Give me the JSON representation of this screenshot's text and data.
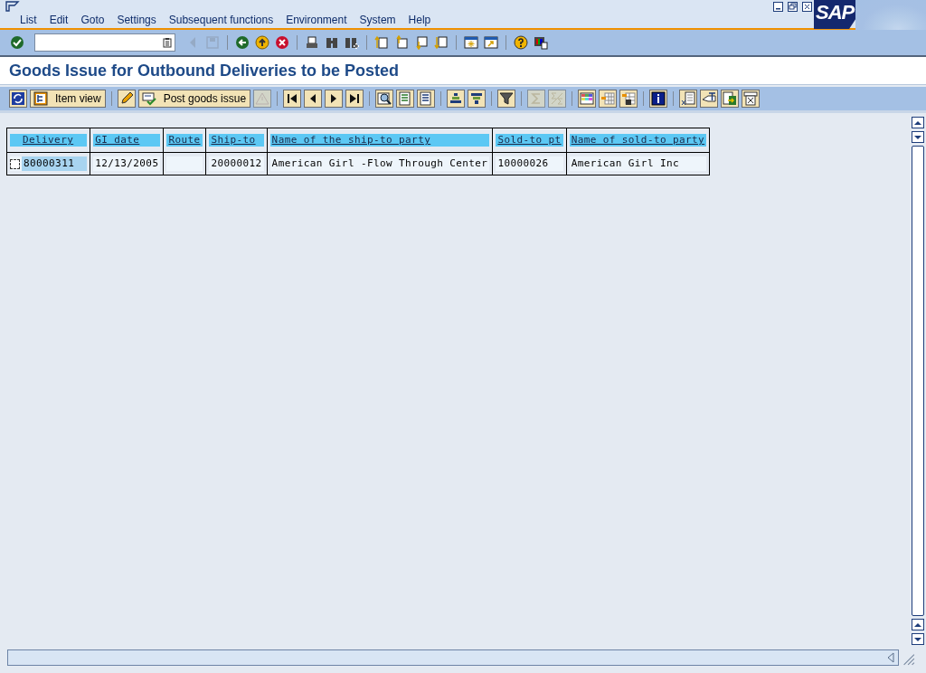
{
  "menu_bar": {
    "items": [
      "List",
      "Edit",
      "Goto",
      "Settings",
      "Subsequent functions",
      "Environment",
      "System",
      "Help"
    ]
  },
  "logo": "SAP",
  "system_toolbar": [
    {
      "kind": "icon",
      "disabled": false
    },
    {
      "kind": "field"
    },
    {
      "kind": "icon",
      "disabled": true
    },
    {
      "kind": "icon",
      "disabled": true
    },
    {
      "kind": "sep"
    },
    {
      "kind": "icon",
      "disabled": false
    },
    {
      "kind": "icon",
      "disabled": false
    },
    {
      "kind": "icon",
      "disabled": false
    },
    {
      "kind": "sep"
    },
    {
      "kind": "icon",
      "disabled": false
    },
    {
      "kind": "icon",
      "disabled": false
    },
    {
      "kind": "icon",
      "disabled": false
    },
    {
      "kind": "sep"
    },
    {
      "kind": "icon",
      "disabled": false
    },
    {
      "kind": "icon",
      "disabled": false
    },
    {
      "kind": "icon",
      "disabled": false
    },
    {
      "kind": "icon",
      "disabled": false
    },
    {
      "kind": "sep"
    },
    {
      "kind": "icon",
      "disabled": false
    },
    {
      "kind": "icon",
      "disabled": false
    },
    {
      "kind": "sep"
    },
    {
      "kind": "icon",
      "disabled": false
    },
    {
      "kind": "icon",
      "disabled": false
    }
  ],
  "title": "Goods Issue for Outbound Deliveries to be Posted",
  "application_toolbar": [
    {
      "kind": "icon",
      "disabled": false
    },
    {
      "kind": "button",
      "label": "Item view",
      "disabled": false
    },
    {
      "kind": "sep"
    },
    {
      "kind": "icon",
      "disabled": false
    },
    {
      "kind": "button",
      "label": "Post goods issue",
      "disabled": false
    },
    {
      "kind": "icon",
      "disabled": true
    },
    {
      "kind": "sep"
    },
    {
      "kind": "icon",
      "disabled": false
    },
    {
      "kind": "icon",
      "disabled": false
    },
    {
      "kind": "icon",
      "disabled": false
    },
    {
      "kind": "icon",
      "disabled": false
    },
    {
      "kind": "sep"
    },
    {
      "kind": "icon",
      "disabled": false
    },
    {
      "kind": "icon",
      "disabled": false
    },
    {
      "kind": "icon",
      "disabled": false
    },
    {
      "kind": "sep"
    },
    {
      "kind": "icon",
      "disabled": false
    },
    {
      "kind": "icon",
      "disabled": false
    },
    {
      "kind": "sep"
    },
    {
      "kind": "icon",
      "disabled": false
    },
    {
      "kind": "sep"
    },
    {
      "kind": "icon",
      "disabled": true
    },
    {
      "kind": "icon",
      "disabled": true
    },
    {
      "kind": "sep"
    },
    {
      "kind": "icon",
      "disabled": false
    },
    {
      "kind": "icon",
      "disabled": false
    },
    {
      "kind": "icon",
      "disabled": false
    },
    {
      "kind": "sep"
    },
    {
      "kind": "icon",
      "disabled": false
    },
    {
      "kind": "sep"
    },
    {
      "kind": "icon",
      "disabled": false
    },
    {
      "kind": "icon",
      "disabled": false
    },
    {
      "kind": "icon",
      "disabled": false
    },
    {
      "kind": "icon",
      "disabled": false
    }
  ],
  "table": {
    "columns": [
      "Delivery",
      "GI date",
      "Route",
      "Ship-to",
      "Name of the ship-to party",
      "Sold-to pt",
      "Name of sold-to party"
    ],
    "rows": [
      {
        "checked": false,
        "cells": [
          "80000311",
          "12/13/2005",
          null,
          "20000012",
          "American Girl -Flow Through Center",
          "10000026",
          "American Girl Inc"
        ]
      }
    ]
  }
}
